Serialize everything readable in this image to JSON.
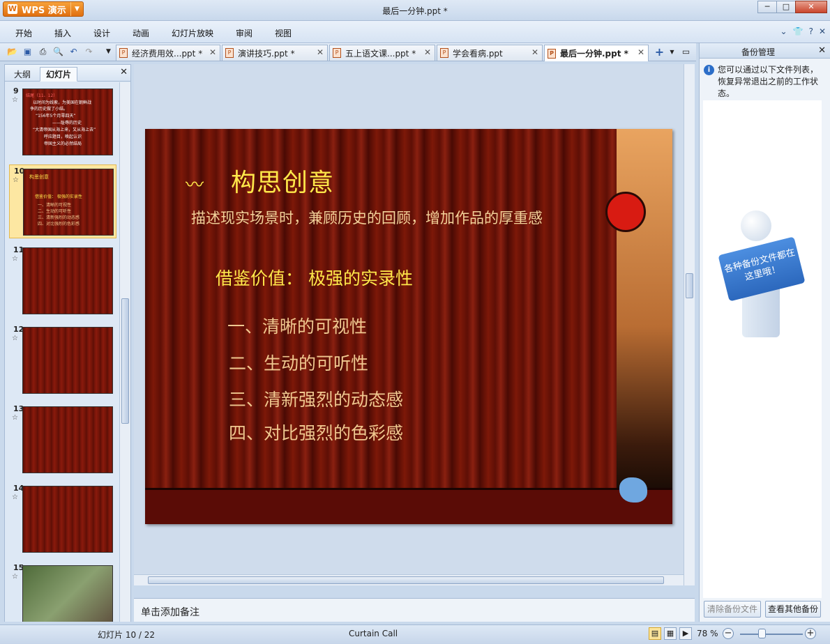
{
  "app": {
    "button_label": "WPS 演示",
    "window_title": "最后一分钟.ppt *"
  },
  "menu": [
    "开始",
    "插入",
    "设计",
    "动画",
    "幻灯片放映",
    "审阅",
    "视图"
  ],
  "tabs": [
    {
      "label": "经济费用效...ppt *"
    },
    {
      "label": "演讲技巧.ppt *"
    },
    {
      "label": "五上语文课...ppt *"
    },
    {
      "label": "学会看病.ppt"
    },
    {
      "label": "最后一分钟.ppt *"
    }
  ],
  "left_panel": {
    "tab_outline": "大纲",
    "tab_slides": "幻灯片",
    "thumbnails": [
      {
        "num": "9"
      },
      {
        "num": "10"
      },
      {
        "num": "11"
      },
      {
        "num": "12"
      },
      {
        "num": "13"
      },
      {
        "num": "14"
      },
      {
        "num": "15"
      }
    ],
    "selected_index": 1
  },
  "slide": {
    "title": "构思创意",
    "subtitle": "描述现实场景时，兼顾历史的回顾，增加作品的厚重感",
    "heading": "借鉴价值：  极强的实录性",
    "items": [
      "一、清晰的可视性",
      "二、生动的可听性",
      "三、清新强烈的动态感",
      "四、对比强烈的色彩感"
    ]
  },
  "notes_placeholder": "单击添加备注",
  "right_panel": {
    "title": "备份管理",
    "info": "您可以通过以下文件列表，恢复异常退出之前的工作状态。",
    "sign_text": "各种备份文件都在这里哦！",
    "clear_button": "清除备份文件",
    "view_button": "查看其他备份"
  },
  "status": {
    "slide_indicator": "幻灯片 10 / 22",
    "theme": "Curtain Call",
    "zoom": "78 %"
  },
  "thumb9_lines": [
    "结尾（11、12）",
    "以时间为线索，为美国在朝鲜战",
    "争的历史做了小结。",
    "“156年5个月零四天”",
    "——耻辱的历史",
    "“大清帝国从海上来，又从海上去”",
    "呼应题目，唤起认识",
    "帝国主义的必然结局"
  ],
  "colors": {
    "accent_orange": "#e06f10",
    "slide_title": "#ffe84a",
    "slide_body": "#f0c890"
  }
}
